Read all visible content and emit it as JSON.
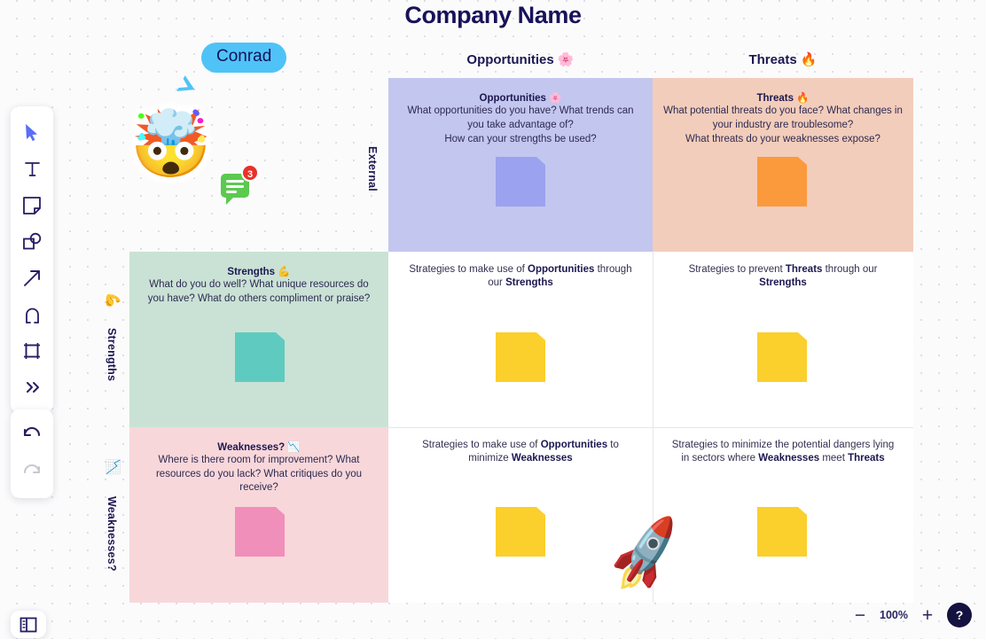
{
  "board": {
    "title": "Company Name",
    "column_headers": {
      "opportunities": "Opportunities 🌸",
      "threats": "Threats 🔥"
    },
    "axis_labels": {
      "external": "External",
      "strengths": "Strengths",
      "strengths_emoji": "💪",
      "weaknesses": "Weaknesses?",
      "weaknesses_emoji": "📉"
    }
  },
  "quadrants": {
    "opportunities": {
      "heading": "Opportunities 🌸",
      "body_line1": "What opportunities do you have? What trends can you take advantage of?",
      "body_line2": "How can your strengths be used?",
      "sticky_color": "#9ba2f0",
      "fill": "#c3c6ee"
    },
    "threats": {
      "heading": "Threats 🔥",
      "body_line1": "What potential threats do you face? What changes in your industry are troublesome?",
      "body_line2": "What threats do your weaknesses expose?",
      "sticky_color": "#fb9a3c",
      "fill": "#f3cdbb"
    },
    "strengths": {
      "heading": "Strengths 💪",
      "body_line1": "What do you do well? What unique resources do you have? What do others compliment or praise?",
      "sticky_color": "#5fcbc0",
      "fill": "#cae2d5"
    },
    "weaknesses": {
      "heading": "Weaknesses? 📉",
      "body_line1": "Where is there room for improvement? What resources do you lack? What critiques do you receive?",
      "sticky_color": "#f08fb9",
      "fill": "#f8d7da"
    }
  },
  "strategies": {
    "so": {
      "prefix": "Strategies to make use of ",
      "bold1": "Opportunities",
      "middle": " through our ",
      "bold2": "Strengths",
      "suffix": ""
    },
    "st": {
      "prefix": "Strategies to prevent ",
      "bold1": "Threats",
      "middle": " through our ",
      "bold2": "Strengths",
      "suffix": ""
    },
    "wo": {
      "prefix": "Strategies to make use of ",
      "bold1": "Opportunities",
      "middle": " to minimize ",
      "bold2": "Weaknesses",
      "suffix": ""
    },
    "wt": {
      "prefix": "Strategies to minimize the potential dangers lying in sectors where ",
      "bold1": "Weaknesses",
      "middle": " meet ",
      "bold2": "Threats",
      "suffix": ""
    },
    "sticky_color": "#fbcf2c"
  },
  "collaborator": {
    "name": "Conrad",
    "cursor_color": "#4fc3f7",
    "sticker": "🤯"
  },
  "comment": {
    "count": "3",
    "bubble_color": "#5cc94f",
    "badge_color": "#e8302a"
  },
  "decorations": {
    "rocket": "🚀"
  },
  "toolbar": {
    "items": [
      {
        "name": "select-tool",
        "label": "Select",
        "active": true
      },
      {
        "name": "text-tool",
        "label": "Text",
        "active": false
      },
      {
        "name": "sticky-tool",
        "label": "Sticky note",
        "active": false
      },
      {
        "name": "shape-tool",
        "label": "Shapes",
        "active": false
      },
      {
        "name": "arrow-tool",
        "label": "Arrow",
        "active": false
      },
      {
        "name": "pen-tool",
        "label": "Pen",
        "active": false
      },
      {
        "name": "frame-tool",
        "label": "Frame",
        "active": false
      },
      {
        "name": "more-tools",
        "label": "More",
        "active": false
      }
    ],
    "undo_label": "Undo",
    "redo_label": "Redo",
    "panel_toggle_label": "Toggle panel"
  },
  "zoom": {
    "out_label": "−",
    "level": "100%",
    "in_label": "+",
    "help_label": "?"
  }
}
